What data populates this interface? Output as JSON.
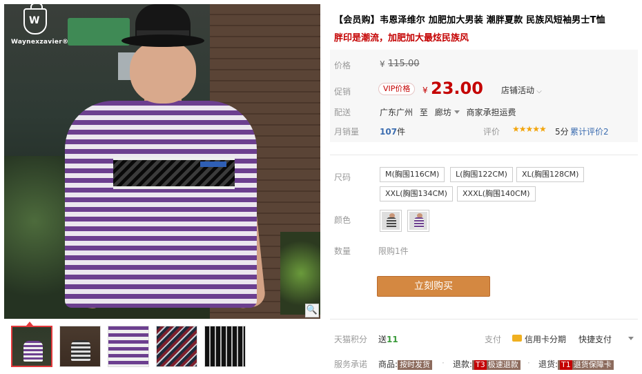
{
  "gallery": {
    "brand": "Waynexzavier",
    "brand_reg": "®",
    "zoom_glyph": "🔍",
    "thumbnails": [
      {
        "name": "thumb-1",
        "active": true
      },
      {
        "name": "thumb-2",
        "active": false
      },
      {
        "name": "thumb-3",
        "active": false
      },
      {
        "name": "thumb-4",
        "active": false
      },
      {
        "name": "thumb-5",
        "active": false
      }
    ]
  },
  "product": {
    "title": "【会员购】韦恩泽维尔 加肥加大男装 潮胖夏款 民族风短袖男士T恤",
    "subtitle": "胖印是潮流，加肥加大最炫民族风"
  },
  "price": {
    "original_label": "价格",
    "currency": "¥",
    "original": "115.00",
    "promo_label": "促销",
    "vip_badge": "VIP价格",
    "current": "23.00",
    "store_promo": "店铺活动",
    "shipping_label": "配送",
    "origin": "广东广州",
    "to": "至",
    "destination": "廊坊",
    "shipping_note": "商家承担运费",
    "sales_label": "月销量",
    "sales_count": "107",
    "sales_unit": "件",
    "rating_label": "评价",
    "stars": "★★★★★",
    "score": "5分",
    "reviews": "累计评价2"
  },
  "options": {
    "size_label": "尺码",
    "sizes": [
      "M(胸围116CM)",
      "L(胸围122CM)",
      "XL(胸围128CM)",
      "XXL(胸围134CM)",
      "XXXL(胸围140CM)"
    ],
    "color_label": "颜色",
    "qty_label": "数量",
    "qty_limit": "限购1件",
    "buy_label": "立刻购买"
  },
  "footer": {
    "points_label": "天猫积分",
    "points_prefix": "送",
    "points_value": "11",
    "pay_label": "支付",
    "credit_label": "信用卡分期",
    "quick_pay": "快捷支付",
    "service_label": "服务承诺",
    "svc1_prefix": "商品:",
    "svc1_tag": "按时发货",
    "svc2_prefix": "退款:",
    "svc2_code": "T3",
    "svc2_tag": "极速退款",
    "svc3_prefix": "退货:",
    "svc3_code": "T1",
    "svc3_tag": "退货保障卡"
  },
  "colors": {
    "accent_red": "#c40000",
    "buy_orange": "#d48841",
    "link_blue": "#3c6db0",
    "star_gold": "#f2a50c"
  }
}
